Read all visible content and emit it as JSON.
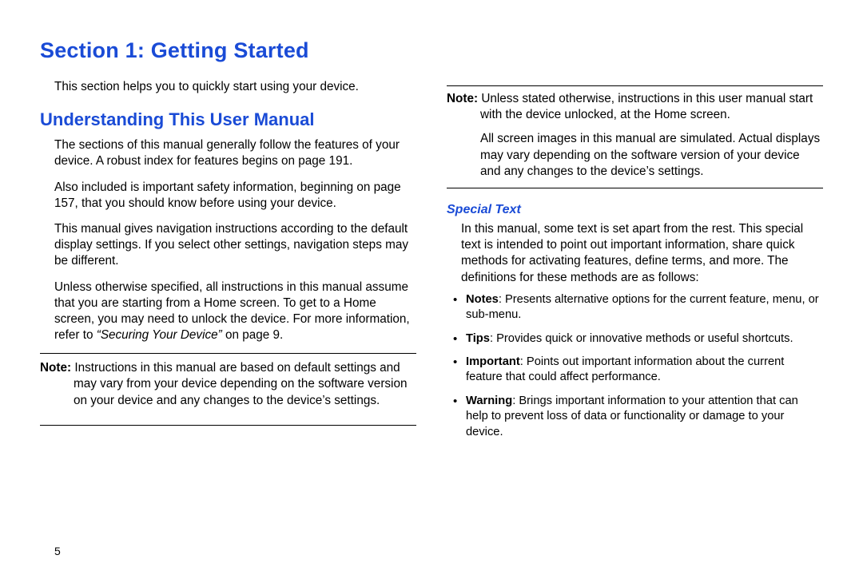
{
  "section_title": "Section 1: Getting Started",
  "left": {
    "intro": "This section helps you to quickly start using your device.",
    "subhead": "Understanding This User Manual",
    "p1": "The sections of this manual generally follow the features of your device. A robust index for features begins on page 191.",
    "p2": "Also included is important safety information, beginning on page 157, that you should know before using your device.",
    "p3": "This manual gives navigation instructions according to the default display settings. If you select other settings, navigation steps may be different.",
    "p4a": "Unless otherwise specified, all instructions in this manual assume that you are starting from a Home screen. To get to a Home screen, you may need to unlock the device. For more information, refer to ",
    "p4_ref": "“Securing Your Device”",
    "p4b": " on page 9.",
    "note_lead": "Note:",
    "note_body": " Instructions in this manual are based on default settings and may vary from your device depending on the software version on your device and any changes to the device’s settings."
  },
  "right": {
    "note_lead": "Note:",
    "note_body": " Unless stated otherwise, instructions in this user manual start with the device unlocked, at the Home screen.",
    "note_p2": "All screen images in this manual are simulated. Actual displays may vary depending on the software version of your device and any changes to the device’s settings.",
    "subsub": "Special Text",
    "intro_p": "In this manual, some text is set apart from the rest. This special text is intended to point out important information, share quick methods for activating features, define terms, and more. The definitions for these methods are as follows:",
    "defs": [
      {
        "term": "Notes",
        "text": ": Presents alternative options for the current feature, menu, or sub-menu."
      },
      {
        "term": "Tips",
        "text": ": Provides quick or innovative methods or useful shortcuts."
      },
      {
        "term": "Important",
        "text": ": Points out important information about the current feature that could affect performance."
      },
      {
        "term": "Warning",
        "text": ": Brings important information to your attention that can help to prevent loss of data or functionality or damage to your device."
      }
    ]
  },
  "page_number": "5"
}
